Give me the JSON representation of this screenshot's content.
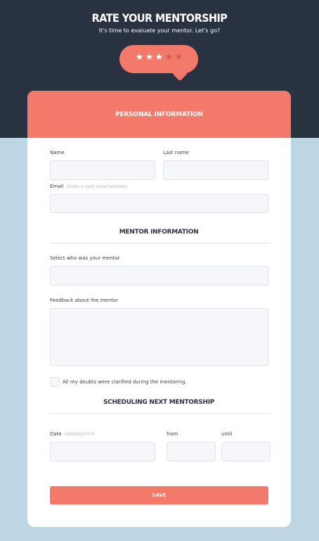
{
  "header": {
    "title": "RATE YOUR MENTORSHIP",
    "subtitle": "It's time to evaluate your mentor. Let's go?"
  },
  "rating": {
    "value": 3,
    "max": 5,
    "filled_color": "#ffffff",
    "empty_color": "#c95f53"
  },
  "card": {
    "personal_section_title": "PERSONAL INFORMATION",
    "name_label": "Name",
    "last_name_label": "Last name",
    "email_label": "Email",
    "email_hint": "(Enter a valid email address)",
    "mentor_section_title": "MENTOR INFORMATION",
    "mentor_select_label": "Select who was your mentor",
    "feedback_label": "Feedback about the mentor",
    "doubts_checkbox_label": "All my doubts were clarified during the mentoring.",
    "scheduling_section_title": "SCHEDULING NEXT MENTORSHIP",
    "date_label": "Date",
    "date_hint": "(MM/DD/YYYY)",
    "from_label": "from",
    "until_label": "until",
    "save_label": "SAVE"
  },
  "colors": {
    "accent": "#f37a6b",
    "dark_header": "#293241",
    "background": "#bed6e3"
  }
}
